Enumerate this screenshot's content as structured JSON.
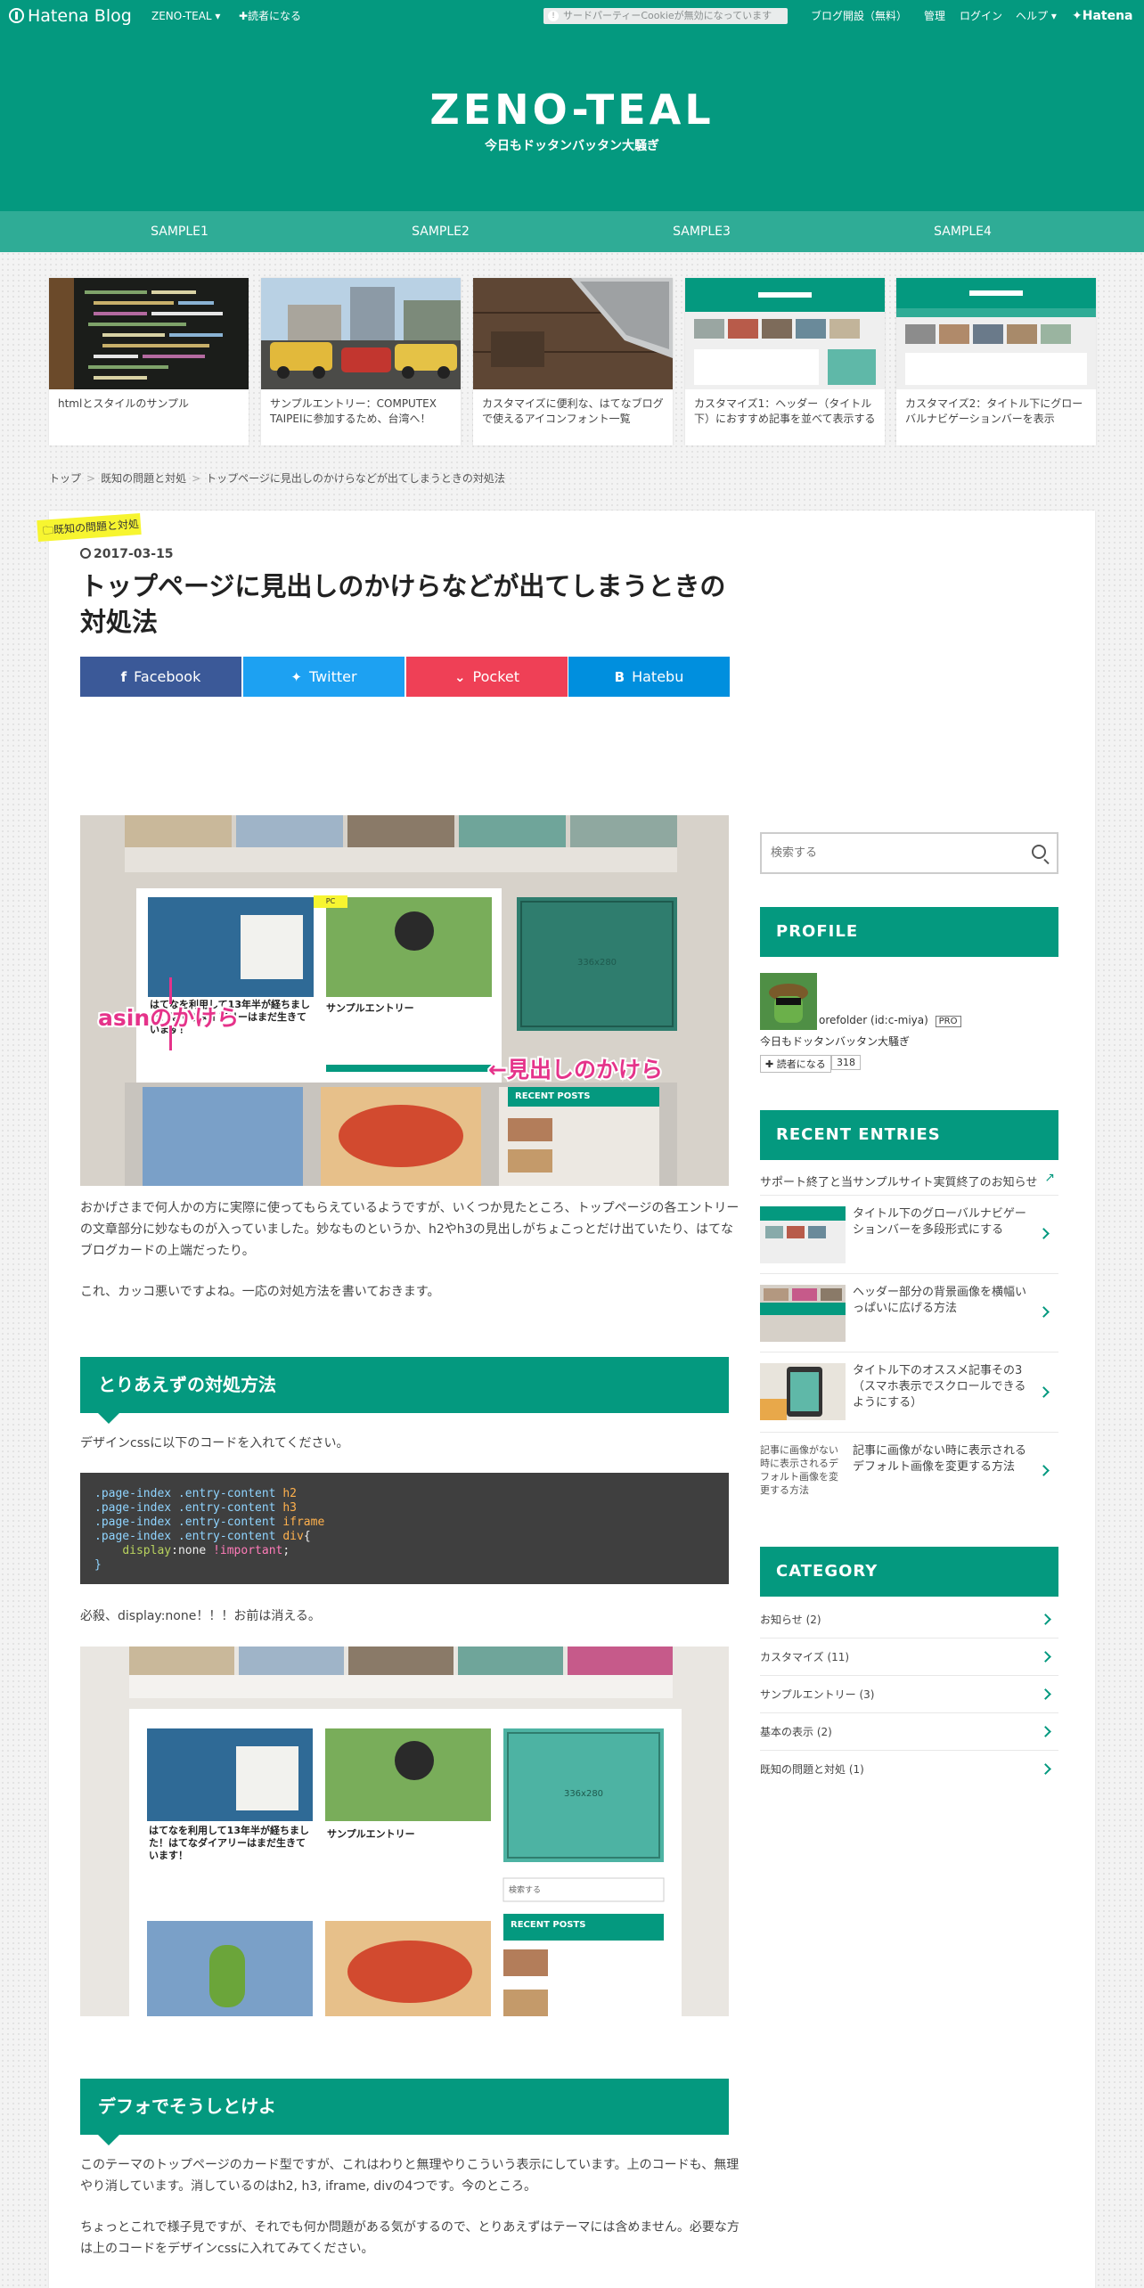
{
  "topbar": {
    "logo": "Hatena Blog",
    "blog_menu": "ZENO-TEAL ▾",
    "subscribe": "✚読者になる",
    "cookie_notice": "サードパーティーCookieが無効になっています",
    "cookie_info_icon": "!",
    "open_blog": "ブログ開設（無料）",
    "admin": "管理",
    "login": "ログイン",
    "help": "ヘルプ ▾",
    "hatena": "Hatena"
  },
  "header": {
    "title": "ZENO-TEAL",
    "description": "今日もドッタンバッタン大騒ぎ"
  },
  "nav": [
    "SAMPLE1",
    "SAMPLE2",
    "SAMPLE3",
    "SAMPLE4"
  ],
  "pickup": [
    {
      "title": "htmlとスタイルのサンプル"
    },
    {
      "title": "サンプルエントリー：COMPUTEX TAIPEIに参加するため、台湾へ！"
    },
    {
      "title": "カスタマイズに便利な、はてなブログで使えるアイコンフォント一覧"
    },
    {
      "title": "カスタマイズ1：ヘッダー（タイトル下）におすすめ記事を並べて表示する"
    },
    {
      "title": "カスタマイズ2：タイトル下にグローバルナビゲーションバーを表示"
    }
  ],
  "breadcrumb": [
    "トップ",
    "既知の問題と対処",
    "トップページに見出しのかけらなどが出てしまうときの対処法"
  ],
  "breadcrumb_sep": ">",
  "entry": {
    "category": "既知の問題と対処",
    "date": "2017-03-15",
    "title": "トップページに見出しのかけらなどが出てしまうときの対処法",
    "share": {
      "facebook": "Facebook",
      "twitter": "Twitter",
      "pocket": "Pocket",
      "hatebu": "Hatebu",
      "facebook_icon": "f",
      "twitter_icon": "✦",
      "pocket_icon": "⌄",
      "hatebu_icon": "B"
    },
    "shot1": {
      "annotation_asin": "asinのかけら",
      "annotation_heading": "←見出しのかけら",
      "card_left_title": "はてなを利用して13年半が経ちました！はてなダイアリーはまだ生きています！",
      "card_right_title": "サンプルエントリー",
      "ad_label": "336x280",
      "recent_posts": "RECENT POSTS"
    },
    "para1": "おかげさまで何人かの方に実際に使ってもらえているようですが、いくつか見たところ、トップページの各エントリーの文章部分に妙なものが入っていました。妙なものというか、h2やh3の見出しがちょこっとだけ出ていたり、はてなブログカードの上端だったり。",
    "para2": "これ、カッコ悪いですよね。一応の対処方法を書いておきます。",
    "h3_1": "とりあえずの対処方法",
    "para3": "デザインcssに以下のコードを入れてください。",
    "code": {
      "l1_sel": ".page-index .entry-content",
      "l1_tag": "h2",
      "l2_sel": ".page-index .entry-content",
      "l2_tag": "h3",
      "l3_sel": ".page-index .entry-content",
      "l3_tag": "iframe",
      "l4_sel": ".page-index .entry-content",
      "l4_tag": "div",
      "l4_open": "{",
      "l5_prop": "display",
      "l5_colon": ":",
      "l5_val": "none",
      "l5_imp": "!important",
      "l5_semi": ";",
      "l6_close": "}"
    },
    "para4": "必殺、display:none！！！お前は消える。",
    "shot2": {
      "card_left_title": "はてなを利用して13年半が経ちました！はてなダイアリーはまだ生きています！",
      "card_right_title": "サンプルエントリー",
      "ad_label": "336x280",
      "search_placeholder": "検索する",
      "recent_posts": "RECENT POSTS"
    },
    "h3_2": "デフォでそうしとけよ",
    "para5": "このテーマのトップページのカード型ですが、これはわりと無理やりこういう表示にしています。上のコードも、無理やり消しています。消しているのはh2, h3, iframe, divの4つです。今のところ。",
    "para6": "ちょっとこれで様子見ですが、それでも何か問題がある気がするので、とりあえずはテーマには含めません。必要な方は上のコードをデザインcssに入れてみてください。"
  },
  "sidebar": {
    "search_placeholder": "検索する",
    "profile": {
      "heading": "PROFILE",
      "name": "orefolder (id:c-miya)",
      "badge": "PRO",
      "desc": "今日もドッタンバッタン大騒ぎ",
      "subscribe": "✚ 読者になる",
      "count": "318"
    },
    "recent": {
      "heading": "RECENT ENTRIES",
      "top": "サポート終了と当サンプルサイト実質終了のお知らせ",
      "items": [
        "タイトル下のグローバルナビゲーションバーを多段形式にする",
        "ヘッダー部分の背景画像を横幅いっぱいに広げる方法",
        "タイトル下のオススメ記事その3（スマホ表示でスクロールできるようにする）",
        "記事に画像がない時に表示されるデフォルト画像を変更する方法"
      ],
      "broken_img_alt": "記事に画像がない時に表示されるデフォルト画像を変更する方法"
    },
    "category": {
      "heading": "CATEGORY",
      "items": [
        "お知らせ (2)",
        "カスタマイズ (11)",
        "サンプルエントリー (3)",
        "基本の表示 (2)",
        "既知の問題と対処 (1)"
      ]
    }
  },
  "colors": {
    "brand": "#04997f",
    "nav": "#2fac96",
    "facebook": "#3b5998",
    "twitter": "#1da1f2",
    "pocket": "#ef4056",
    "hatebu": "#008fde",
    "tag": "#f7f530"
  }
}
